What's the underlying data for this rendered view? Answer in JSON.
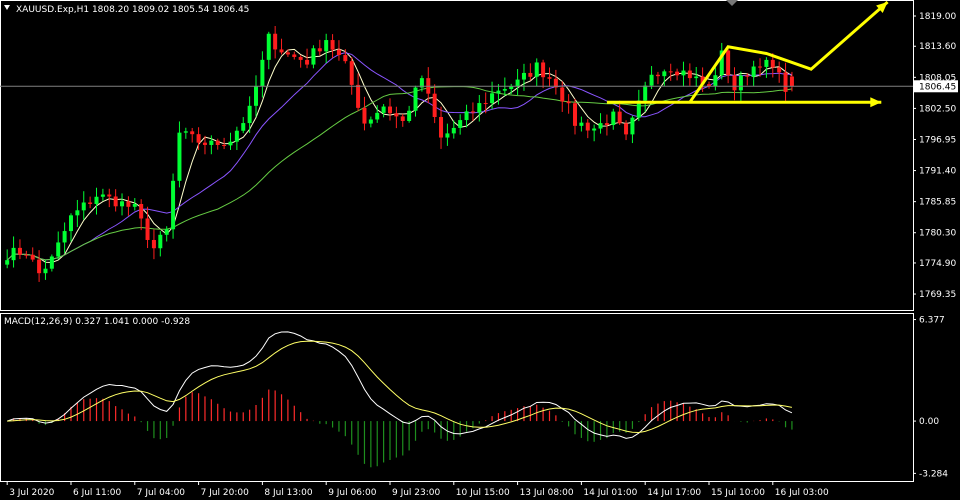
{
  "window": {
    "main_title": "XAUUSD.Exp,H1  1808.20 1809.02 1805.54 1806.45",
    "indicator_title": "MACD(12,26,9) 0.327 1.041 0.000 -0.928"
  },
  "colors": {
    "background": "#000000",
    "bull_candle": "#00ff33",
    "bear_candle": "#ff1e1e",
    "ma_fast": "#ffffcc",
    "ma_mid": "#8a55ff",
    "ma_slow": "#66cc44",
    "annotation": "#ffff00",
    "macd_line": "#ffffff",
    "signal_line": "#ffff66",
    "hist_pos": "#ff2b2b",
    "hist_neg": "#1e8f1e"
  },
  "chart_data": [
    {
      "type": "candlestick",
      "symbol": "XAUUSD.Exp",
      "timeframe": "H1",
      "bar_count": 140,
      "ohlc_last": {
        "open": 1808.2,
        "high": 1809.02,
        "low": 1805.54,
        "close": 1806.45
      },
      "ylim": [
        1766.5,
        1821.5
      ],
      "y_ticks": [
        "1819.00",
        "1813.60",
        "1808.05",
        "1802.50",
        "1796.95",
        "1791.40",
        "1785.85",
        "1780.30",
        "1774.90",
        "1769.35"
      ],
      "current_price_label": "1806.45",
      "x_ticks": [
        {
          "bar": 0,
          "label": "3 Jul 2020"
        },
        {
          "bar": 10,
          "label": "6 Jul 11:00"
        },
        {
          "bar": 20,
          "label": "7 Jul 04:00"
        },
        {
          "bar": 30,
          "label": "7 Jul 20:00"
        },
        {
          "bar": 40,
          "label": "8 Jul 13:00"
        },
        {
          "bar": 50,
          "label": "9 Jul 06:00"
        },
        {
          "bar": 60,
          "label": "9 Jul 23:00"
        },
        {
          "bar": 70,
          "label": "10 Jul 15:00"
        },
        {
          "bar": 80,
          "label": "13 Jul 08:00"
        },
        {
          "bar": 90,
          "label": "14 Jul 01:00"
        },
        {
          "bar": 100,
          "label": "14 Jul 17:00"
        },
        {
          "bar": 110,
          "label": "15 Jul 10:00"
        },
        {
          "bar": 120,
          "label": "16 Jul 03:00"
        }
      ],
      "close_anchors": [
        [
          0,
          1776.5
        ],
        [
          3,
          1777.0
        ],
        [
          5,
          1773.0
        ],
        [
          7,
          1775.5
        ],
        [
          10,
          1783.0
        ],
        [
          14,
          1787.0
        ],
        [
          17,
          1786.0
        ],
        [
          20,
          1784.5
        ],
        [
          23,
          1777.5
        ],
        [
          25,
          1780.5
        ],
        [
          27,
          1798.0
        ],
        [
          29,
          1797.0
        ],
        [
          32,
          1796.0
        ],
        [
          35,
          1797.0
        ],
        [
          38,
          1802.0
        ],
        [
          41,
          1815.0
        ],
        [
          44,
          1812.0
        ],
        [
          47,
          1811.0
        ],
        [
          50,
          1815.0
        ],
        [
          53,
          1810.0
        ],
        [
          56,
          1800.0
        ],
        [
          59,
          1803.0
        ],
        [
          62,
          1800.0
        ],
        [
          65,
          1808.0
        ],
        [
          68,
          1797.0
        ],
        [
          71,
          1800.0
        ],
        [
          74,
          1803.0
        ],
        [
          77,
          1806.0
        ],
        [
          80,
          1807.0
        ],
        [
          83,
          1810.0
        ],
        [
          86,
          1807.0
        ],
        [
          89,
          1800.0
        ],
        [
          92,
          1799.0
        ],
        [
          95,
          1801.0
        ],
        [
          97,
          1797.0
        ],
        [
          99,
          1803.0
        ],
        [
          101,
          1809.0
        ],
        [
          104,
          1810.0
        ],
        [
          107,
          1808.5
        ],
        [
          110,
          1806.0
        ],
        [
          112,
          1812.0
        ],
        [
          114,
          1806.0
        ],
        [
          116,
          1809.0
        ],
        [
          118,
          1811.0
        ],
        [
          120,
          1809.5
        ],
        [
          122,
          1806.5
        ],
        [
          123,
          1806.45
        ]
      ],
      "moving_averages": [
        {
          "period": 5,
          "color_key": "ma_fast"
        },
        {
          "period": 14,
          "color_key": "ma_mid"
        },
        {
          "period": 34,
          "color_key": "ma_slow"
        }
      ],
      "annotations": [
        {
          "type": "horizontal_line",
          "price": 1806.45,
          "color": "#808080"
        },
        {
          "type": "arrow",
          "points": [
            [
              107,
              1803.6
            ],
            [
              113,
              1813.5
            ],
            [
              119,
              1812.3
            ],
            [
              126,
              1809.5
            ],
            [
              138,
              1821.5
            ]
          ],
          "color": "#ffff00"
        },
        {
          "type": "arrow",
          "points": [
            [
              94,
              1803.6
            ],
            [
              137,
              1803.6
            ]
          ],
          "color": "#ffff00"
        }
      ]
    },
    {
      "type": "macd",
      "fast": 12,
      "slow": 26,
      "signal": 9,
      "values": {
        "macd": 0.327,
        "signal": 1.041
      },
      "ylim": [
        -3.7,
        6.6
      ],
      "y_ticks": [
        "6.377",
        "0.00",
        "-3.284"
      ]
    }
  ]
}
